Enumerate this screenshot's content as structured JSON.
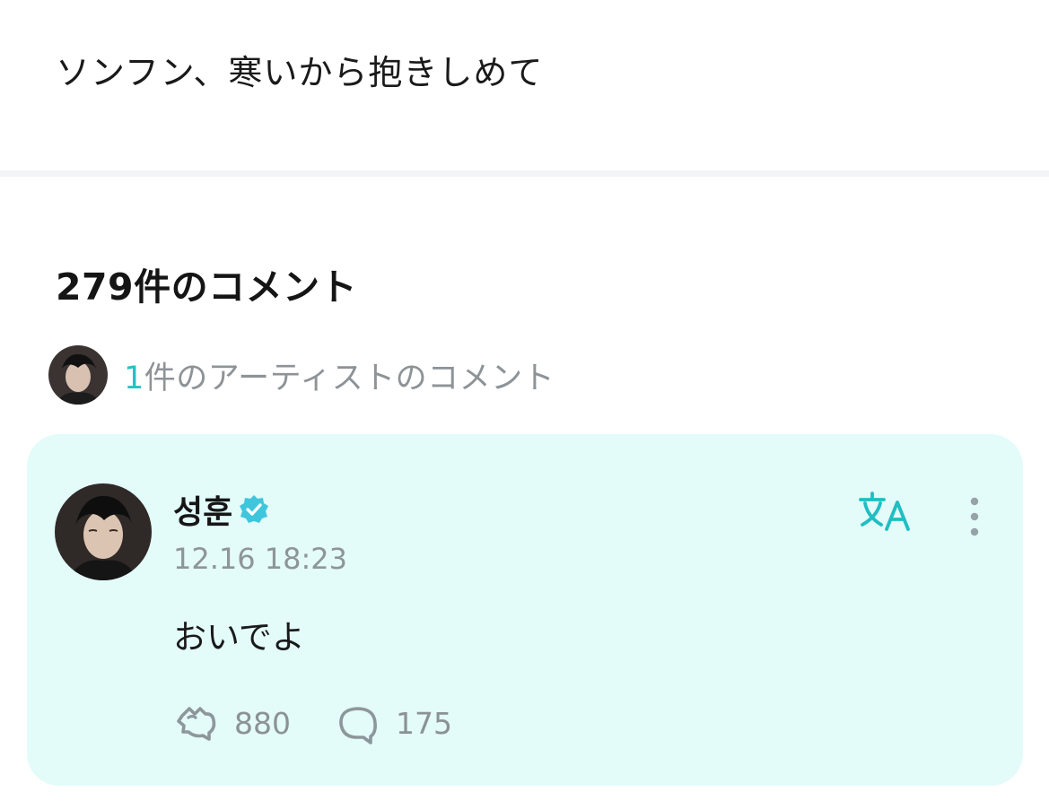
{
  "post": {
    "text": "ソンフン、寒いから抱きしめて"
  },
  "comments": {
    "title": "279件のコメント",
    "artist_summary_count": "1",
    "artist_summary_text": "件のアーティストのコメント"
  },
  "artist_comment": {
    "author": "성훈",
    "timestamp": "12.16 18:23",
    "body": "おいでよ",
    "likes": "880",
    "replies": "175"
  },
  "icons": {
    "verified": "verified-badge-icon",
    "translate": "translate-icon",
    "more": "more-vertical-icon",
    "like": "like-icon",
    "reply": "reply-icon"
  },
  "colors": {
    "accent": "#25c2c6",
    "card_background": "#e3fbf9",
    "muted_text": "#8d9397"
  }
}
